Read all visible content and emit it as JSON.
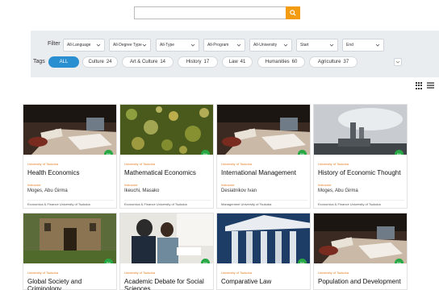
{
  "search": {
    "placeholder": "",
    "value": ""
  },
  "filters": {
    "label": "Filter",
    "selects": [
      "All-Language",
      "All-Degree Type",
      "All-Type",
      "All-Program",
      "All-University",
      "Start",
      "End"
    ]
  },
  "tags": {
    "label": "Tags",
    "items": [
      {
        "name": "ALL",
        "count": ""
      },
      {
        "name": "Culture",
        "count": "24"
      },
      {
        "name": "Art & Culture",
        "count": "14"
      },
      {
        "name": "History",
        "count": "17"
      },
      {
        "name": "Law",
        "count": "41"
      },
      {
        "name": "Humanities",
        "count": "60"
      },
      {
        "name": "Agriculture",
        "count": "37"
      }
    ]
  },
  "courses": [
    {
      "university": "University of Tsukuba",
      "title": "Health Economics",
      "instructor_label": "Instructor",
      "instructor": "Moges, Abu Girma",
      "footer": "Economics & Finance  University of Tsukuba",
      "badge": "EN"
    },
    {
      "university": "University of Tsukuba",
      "title": "Mathematical Economics",
      "instructor_label": "Instructor",
      "instructor": "Ikeuchi, Masako",
      "footer": "Economics & Finance  University of Tsukuba",
      "badge": "EN"
    },
    {
      "university": "University of Tsukuba",
      "title": "International Management",
      "instructor_label": "Instructor",
      "instructor": "Desiatnikov Ivan",
      "footer": "Management  University of Tsukuba",
      "badge": "EN"
    },
    {
      "university": "University of Tsukuba",
      "title": "History of Economic Thought",
      "instructor_label": "Instructor",
      "instructor": "Moges, Abu Girma",
      "footer": "Economics & Finance  University of Tsukuba",
      "badge": "EN"
    },
    {
      "university": "University of Tsukuba",
      "title": "Global Society and Criminology",
      "instructor_label": "",
      "instructor": "",
      "footer": "",
      "badge": "EN"
    },
    {
      "university": "University of Tsukuba",
      "title": "Academic Debate for Social Sciences",
      "instructor_label": "",
      "instructor": "",
      "footer": "",
      "badge": "EN"
    },
    {
      "university": "University of Tsukuba",
      "title": "Comparative Law",
      "instructor_label": "",
      "instructor": "",
      "footer": "",
      "badge": "EN"
    },
    {
      "university": "University of Tsukuba",
      "title": "Population and Development",
      "instructor_label": "",
      "instructor": "",
      "footer": "",
      "badge": "EN"
    }
  ],
  "colors": {
    "accent": "#2a8fd0",
    "search_button": "#f39c12",
    "badge": "#27a844",
    "label": "#e67e22"
  }
}
